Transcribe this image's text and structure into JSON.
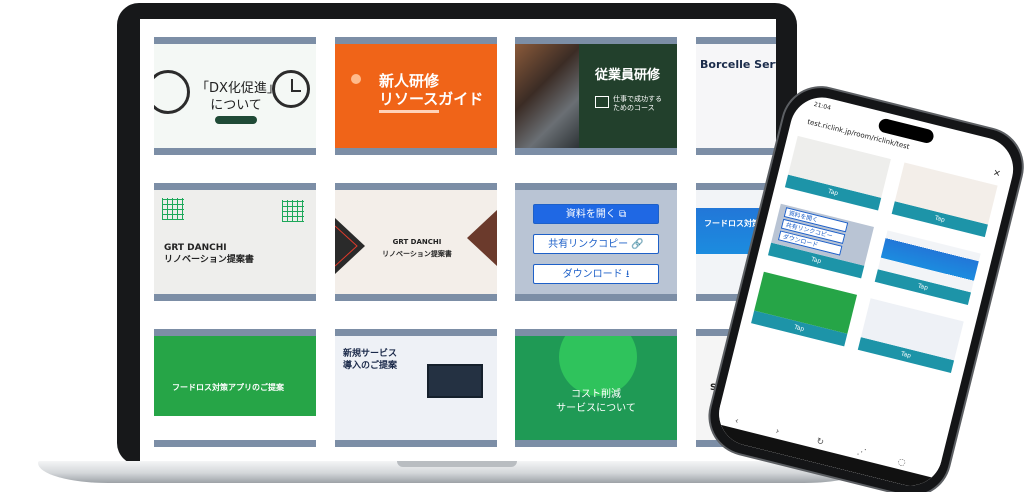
{
  "slides": {
    "s1": {
      "title_line1": "「DX化促進」",
      "title_line2": "について"
    },
    "s2": {
      "title_line1": "新人研修",
      "title_line2": "リソースガイド"
    },
    "s3": {
      "title": "従業員研修",
      "sub_line1": "仕事で成功する",
      "sub_line2": "ためのコース"
    },
    "s4": {
      "title": "Borcelle Servic"
    },
    "s5": {
      "title_line1": "GRT DANCHI",
      "title_line2": "リノベーション提案書"
    },
    "s6": {
      "title_line1": "GRT DANCHI",
      "title_line2": "リノベーション提案書"
    },
    "s7": {
      "open": "資料を開く ⧉",
      "share": "共有リンクコピー 🔗",
      "download": "ダウンロード ⭳"
    },
    "s8": {
      "title": "フードロス対策アプリ"
    },
    "s9": {
      "title": "フードロス対策アプリのご提案"
    },
    "s10": {
      "title_line1": "新規サービス",
      "title_line2": "導入のご提案"
    },
    "s11": {
      "title_line1": "コスト削減",
      "title_line2": "サービスについて"
    },
    "s12": {
      "title": "SNS集"
    }
  },
  "phone": {
    "status_time": "21:04",
    "url": "test.riclink.jp/room/riclink/test",
    "close": "✕",
    "tap_label": "Tap",
    "overlay_open": "資料を開く",
    "overlay_share": "共有リンクコピー",
    "overlay_download": "ダウンロード"
  },
  "colors": {
    "slide_border": "#7c8ea6",
    "tap_button": "#1d94a8",
    "primary_blue": "#1f68e4"
  }
}
